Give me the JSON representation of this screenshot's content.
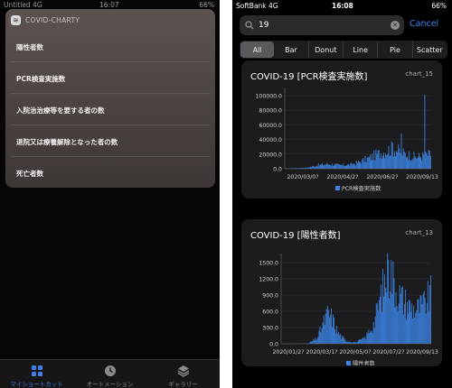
{
  "left": {
    "status": {
      "carrier": "Untitled 4G",
      "time": "16:07",
      "battery": "66%"
    },
    "widget": {
      "icon": "layers-icon",
      "title": "COVID-CHARTY",
      "items": [
        {
          "label": "陽性者数"
        },
        {
          "label": "PCR検査実施数"
        },
        {
          "label": "入院治治療等を要する者の数"
        },
        {
          "label": "退院又は療養解除となった者の数"
        },
        {
          "label": "死亡者数"
        }
      ]
    },
    "tabs": [
      {
        "label": "マイショートカット",
        "icon": "grid-icon",
        "active": true
      },
      {
        "label": "オートメーション",
        "icon": "clock-icon",
        "active": false
      },
      {
        "label": "ギャラリー",
        "icon": "stack-icon",
        "active": false
      }
    ]
  },
  "right": {
    "status": {
      "carrier": "SoftBank 4G",
      "time": "16:08",
      "battery": "66%"
    },
    "search": {
      "value": "19",
      "placeholder": "Search",
      "cancel_label": "Cancel"
    },
    "filters": [
      "All",
      "Bar",
      "Donut",
      "Line",
      "Pie",
      "Scatter"
    ],
    "selected_filter": "All",
    "accent": "#3d86f5",
    "cards": [
      {
        "title": "COVID-19 [PCR検査実施数]",
        "id": "chart_15"
      },
      {
        "title": "COVID-19 [陽性者数]",
        "id": "chart_13"
      }
    ]
  },
  "chart_data": [
    {
      "type": "bar",
      "title": "COVID-19 [PCR検査実施数]",
      "xlabel": "",
      "ylabel": "",
      "ylim": [
        0,
        110000
      ],
      "yticks": [
        "0.0",
        "20000.0",
        "40000.0",
        "60000.0",
        "80000.0",
        "100000.0"
      ],
      "xticks": [
        "2020/03/0?",
        "2020/04/2?",
        "2020/06/2?",
        "2020/09/13"
      ],
      "legend": "PCR検査実施数",
      "legend_position": "bottom",
      "color": "#3b82e0",
      "profile": [
        [
          0,
          400
        ],
        [
          0.15,
          1500
        ],
        [
          0.22,
          5000
        ],
        [
          0.3,
          7000
        ],
        [
          0.38,
          5000
        ],
        [
          0.45,
          6000
        ],
        [
          0.5,
          9000
        ],
        [
          0.58,
          16000
        ],
        [
          0.64,
          22000
        ],
        [
          0.7,
          27000
        ],
        [
          0.74,
          30000
        ],
        [
          0.78,
          26000
        ],
        [
          0.82,
          22000
        ],
        [
          0.86,
          20000
        ],
        [
          0.9,
          17000
        ],
        [
          0.95,
          19000
        ],
        [
          1,
          21000
        ]
      ],
      "spikes": [
        [
          0.96,
          100000
        ],
        [
          0.8,
          48000
        ],
        [
          0.74,
          35000
        ]
      ]
    },
    {
      "type": "bar",
      "title": "COVID-19 [陽性者数]",
      "xlabel": "",
      "ylabel": "",
      "ylim": [
        0,
        1700
      ],
      "yticks": [
        "0.0",
        "300.0",
        "600.0",
        "900.0",
        "1200.0",
        "1500.0"
      ],
      "xticks": [
        "2020/01/2?",
        "2020/03/1?",
        "2020/05/0?",
        "2020/07/2?",
        "2020/09/13"
      ],
      "legend": "陽性者数",
      "legend_position": "bottom",
      "color": "#3b82e0",
      "profile": [
        [
          0,
          0
        ],
        [
          0.18,
          5
        ],
        [
          0.24,
          120
        ],
        [
          0.28,
          420
        ],
        [
          0.31,
          620
        ],
        [
          0.34,
          520
        ],
        [
          0.38,
          220
        ],
        [
          0.43,
          60
        ],
        [
          0.5,
          30
        ],
        [
          0.56,
          120
        ],
        [
          0.62,
          420
        ],
        [
          0.66,
          900
        ],
        [
          0.7,
          1350
        ],
        [
          0.73,
          1500
        ],
        [
          0.76,
          1180
        ],
        [
          0.8,
          950
        ],
        [
          0.85,
          780
        ],
        [
          0.9,
          700
        ],
        [
          0.95,
          780
        ],
        [
          1,
          1000
        ]
      ],
      "spikes": [
        [
          0.72,
          1580
        ]
      ]
    }
  ]
}
